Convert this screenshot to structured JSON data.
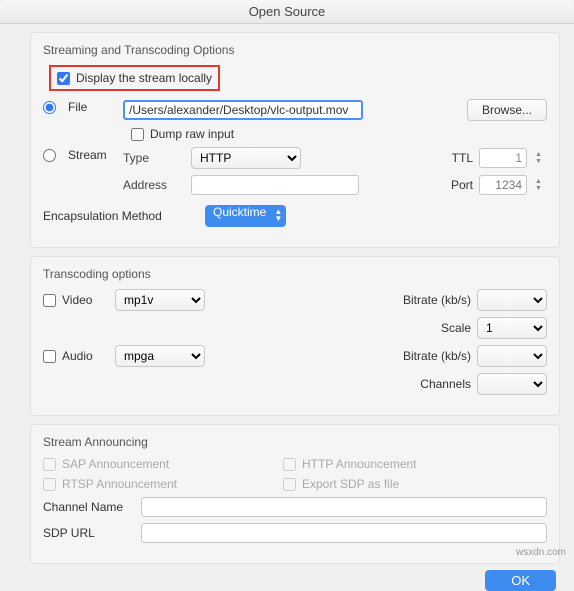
{
  "title": "Open Source",
  "streaming": {
    "section": "Streaming and Transcoding Options",
    "display_locally": "Display the stream locally",
    "file": "File",
    "path": "/Users/alexander/Desktop/vlc-output.mov",
    "browse": "Browse...",
    "dump_raw": "Dump raw input",
    "stream": "Stream",
    "type": "Type",
    "type_value": "HTTP",
    "ttl": "TTL",
    "ttl_value": "1",
    "address": "Address",
    "port": "Port",
    "port_placeholder": "1234",
    "encap": "Encapsulation Method",
    "encap_value": "Quicktime"
  },
  "transcoding": {
    "section": "Transcoding options",
    "video": "Video",
    "video_codec": "mp1v",
    "audio": "Audio",
    "audio_codec": "mpga",
    "bitrate": "Bitrate (kb/s)",
    "scale": "Scale",
    "scale_value": "1",
    "channels": "Channels"
  },
  "announce": {
    "section": "Stream Announcing",
    "sap": "SAP Announcement",
    "http": "HTTP Announcement",
    "rtsp": "RTSP Announcement",
    "export": "Export SDP as file",
    "channel": "Channel Name",
    "sdp": "SDP URL"
  },
  "ok": "OK",
  "watermark": "wsxdn.com"
}
